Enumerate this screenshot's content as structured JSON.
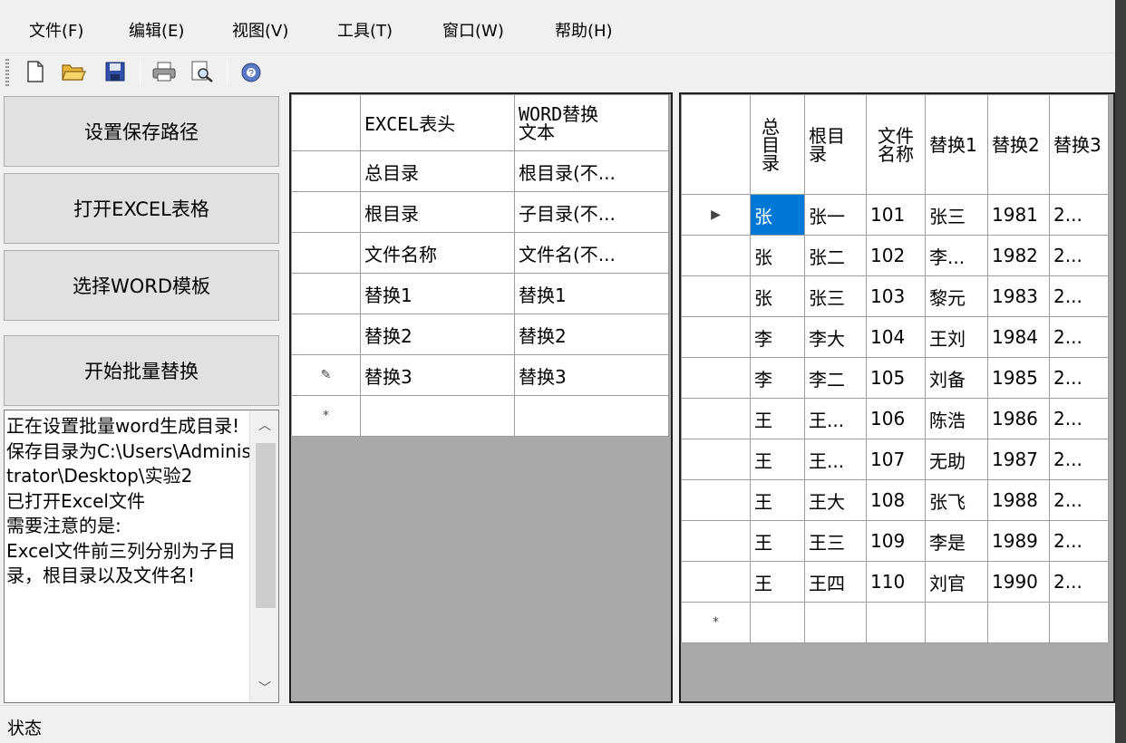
{
  "menu": [
    {
      "label": "文件(F)"
    },
    {
      "label": "编辑(E)"
    },
    {
      "label": "视图(V)"
    },
    {
      "label": "工具(T)"
    },
    {
      "label": "窗口(W)"
    },
    {
      "label": "帮助(H)"
    }
  ],
  "toolbar": {
    "icons": [
      "new-file-icon",
      "open-folder-icon",
      "save-icon",
      "print-icon",
      "print-preview-icon",
      "help-icon"
    ]
  },
  "buttons": {
    "set_path": "设置保存路径",
    "open_excel": "打开EXCEL表格",
    "select_word": "选择WORD模板",
    "start_replace": "开始批量替换"
  },
  "log": {
    "text": "正在设置批量word生成目录!\n保存目录为C:\\Users\\Administrator\\Desktop\\实验2\n已打开Excel文件\n需要注意的是:\nExcel文件前三列分别为子目录，根目录以及文件名!"
  },
  "mapping_grid": {
    "headers": [
      "EXCEL表头",
      "WORD替换\n文本"
    ],
    "rows": [
      {
        "marker": "",
        "cells": [
          "总目录",
          "根目录(不..."
        ]
      },
      {
        "marker": "",
        "cells": [
          "根目录",
          "子目录(不..."
        ]
      },
      {
        "marker": "",
        "cells": [
          "文件名称",
          "文件名(不..."
        ]
      },
      {
        "marker": "",
        "cells": [
          "替换1",
          "替换1"
        ]
      },
      {
        "marker": "",
        "cells": [
          "替换2",
          "替换2"
        ]
      },
      {
        "marker": "✎",
        "cells": [
          "替换3",
          "替换3"
        ]
      },
      {
        "marker": "*",
        "cells": [
          "",
          ""
        ]
      }
    ]
  },
  "data_grid": {
    "headers": [
      "总目录",
      "根目录",
      "文件名称",
      "替换1",
      "替换2",
      "替换3"
    ],
    "rows": [
      {
        "marker": "▶",
        "cells": [
          "张",
          "张一",
          "101",
          "张三",
          "1981",
          "2..."
        ]
      },
      {
        "marker": "",
        "cells": [
          "张",
          "张二",
          "102",
          "李...",
          "1982",
          "2..."
        ]
      },
      {
        "marker": "",
        "cells": [
          "张",
          "张三",
          "103",
          "黎元",
          "1983",
          "2..."
        ]
      },
      {
        "marker": "",
        "cells": [
          "李",
          "李大",
          "104",
          "王刘",
          "1984",
          "2..."
        ]
      },
      {
        "marker": "",
        "cells": [
          "李",
          "李二",
          "105",
          "刘备",
          "1985",
          "2..."
        ]
      },
      {
        "marker": "",
        "cells": [
          "王",
          "王...",
          "106",
          "陈浩",
          "1986",
          "2..."
        ]
      },
      {
        "marker": "",
        "cells": [
          "王",
          "王...",
          "107",
          "无助",
          "1987",
          "2..."
        ]
      },
      {
        "marker": "",
        "cells": [
          "王",
          "王大",
          "108",
          "张飞",
          "1988",
          "2..."
        ]
      },
      {
        "marker": "",
        "cells": [
          "王",
          "王三",
          "109",
          "李是",
          "1989",
          "2..."
        ]
      },
      {
        "marker": "",
        "cells": [
          "王",
          "王四",
          "110",
          "刘官",
          "1990",
          "2..."
        ]
      },
      {
        "marker": "*",
        "cells": [
          "",
          "",
          "",
          "",
          "",
          ""
        ]
      }
    ]
  },
  "status": {
    "label": "状态"
  }
}
